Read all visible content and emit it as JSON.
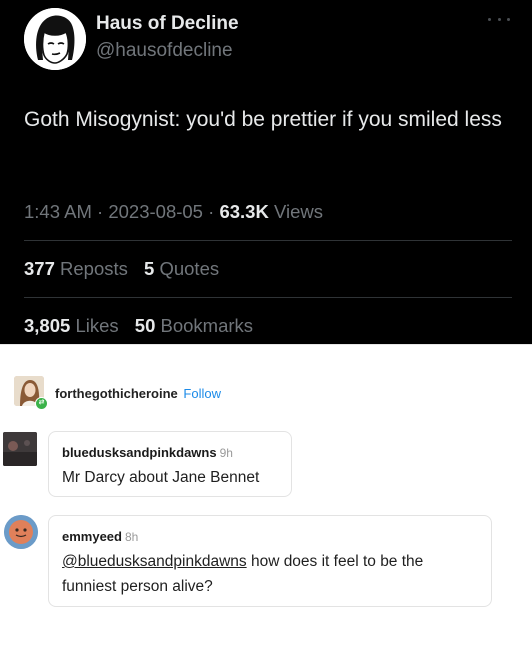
{
  "tweet": {
    "display_name": "Haus of Decline",
    "handle": "@hausofdecline",
    "text": "Goth Misogynist: you'd be prettier if you smiled less",
    "time": "1:43 AM",
    "date": "2023-08-05",
    "views_count": "63.3K",
    "views_label": "Views",
    "reposts_count": "377",
    "reposts_label": "Reposts",
    "quotes_count": "5",
    "quotes_label": "Quotes",
    "likes_count": "3,805",
    "likes_label": "Likes",
    "bookmarks_count": "50",
    "bookmarks_label": "Bookmarks",
    "avatar_icon": "cartoon-face-avatar-icon",
    "more_icon": "more-options-icon"
  },
  "tumblr": {
    "poster": "forthegothicheroine",
    "follow_label": "Follow",
    "reblog_badge_icon": "reblog-icon",
    "replies": [
      {
        "user": "bluedusksandpinkdawns",
        "time": "9h",
        "text": "Mr Darcy about Jane Bennet"
      },
      {
        "user": "emmyeed",
        "time": "8h",
        "mention": "@bluedusksandpinkdawns",
        "text_line1": " how does it feel to be the",
        "text_line2": "funniest person alive?"
      }
    ]
  },
  "colors": {
    "tweet_background": "#000000",
    "tweet_muted": "#71767b",
    "tweet_text": "#e7e9ea",
    "follow_link": "#1c8be8",
    "reblog_badge": "#3bb24a"
  }
}
